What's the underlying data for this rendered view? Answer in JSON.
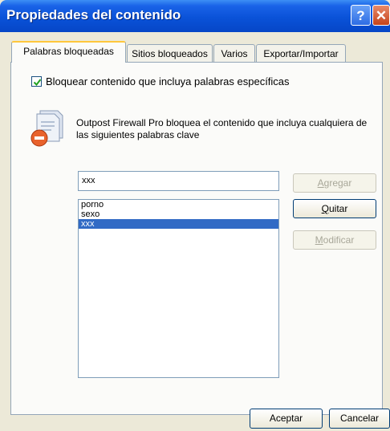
{
  "window": {
    "title": "Propiedades del contenido",
    "help_glyph": "?",
    "close_glyph": "✕"
  },
  "tabs": [
    {
      "label": "Palabras bloqueadas",
      "active": true
    },
    {
      "label": "Sitios bloqueados",
      "active": false
    },
    {
      "label": "Varios",
      "active": false
    },
    {
      "label": "Exportar/Importar",
      "active": false
    }
  ],
  "block_words": {
    "checkbox_label": "Bloquear contenido que incluya palabras específicas",
    "checked": true,
    "description": "Outpost Firewall Pro bloquea el contenido que incluya cualquiera de las siguientes palabras clave",
    "input_value": "xxx",
    "words": [
      "porno",
      "sexo",
      "xxx"
    ],
    "selected_word": "xxx"
  },
  "buttons": {
    "add": {
      "access_key": "A",
      "rest": "gregar",
      "enabled": false
    },
    "remove": {
      "access_key": "Q",
      "rest": "uitar",
      "enabled": true
    },
    "modify": {
      "access_key": "M",
      "rest": "odificar",
      "enabled": false
    },
    "ok": "Aceptar",
    "cancel": "Cancelar"
  },
  "colors": {
    "titlebar": "#0a52d8",
    "selection": "#316ac5",
    "dialog_face": "#ece9d8"
  }
}
